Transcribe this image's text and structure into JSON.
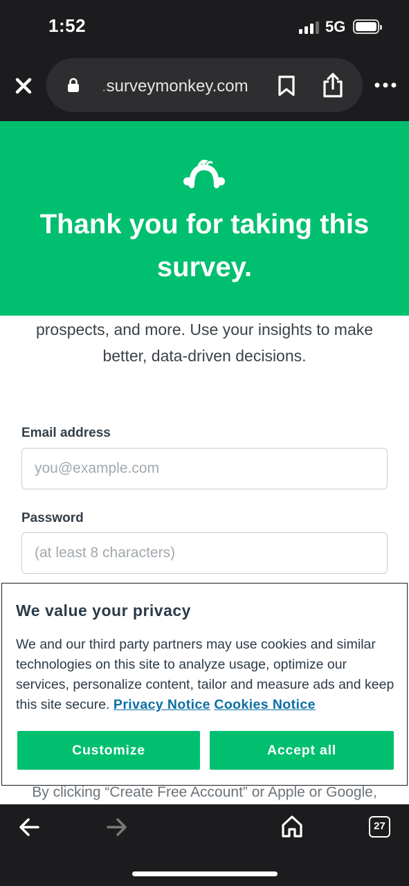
{
  "status_bar": {
    "time": "1:52",
    "network": "5G",
    "icons": [
      "signal-icon",
      "battery-icon"
    ]
  },
  "browser": {
    "url_prefix": ".",
    "url_domain": "surveymonkey.com",
    "icons": [
      "close-icon",
      "lock-icon",
      "bookmark-icon",
      "share-icon",
      "more-icon"
    ]
  },
  "hero": {
    "logo": "surveymonkey-logo",
    "title": "Thank you for taking this survey.",
    "background": "#00bf6f"
  },
  "intro": {
    "text": "prospects, and more. Use your insights to make better, data-driven decisions."
  },
  "signup_form": {
    "email_label": "Email address",
    "email_placeholder": "you@example.com",
    "password_label": "Password",
    "password_placeholder": "(at least 8 characters)"
  },
  "bottom_text": "By clicking “Create Free Account” or Apple or Google,",
  "privacy_banner": {
    "title": "We value your privacy",
    "body": "We and our third party partners may use cookies and similar technologies on this site to analyze usage, optimize our services, personalize content, tailor and measure ads and keep this site secure.",
    "privacy_link": "Privacy Notice",
    "cookies_link": "Cookies Notice",
    "customize_label": "Customize",
    "accept_label": "Accept all",
    "link_color": "#0b6fa4",
    "button_color": "#00bf6f"
  },
  "bottom_bar": {
    "tab_count": "27",
    "icons": [
      "back-arrow-icon",
      "forward-arrow-icon",
      "home-icon",
      "tabs-icon"
    ]
  }
}
